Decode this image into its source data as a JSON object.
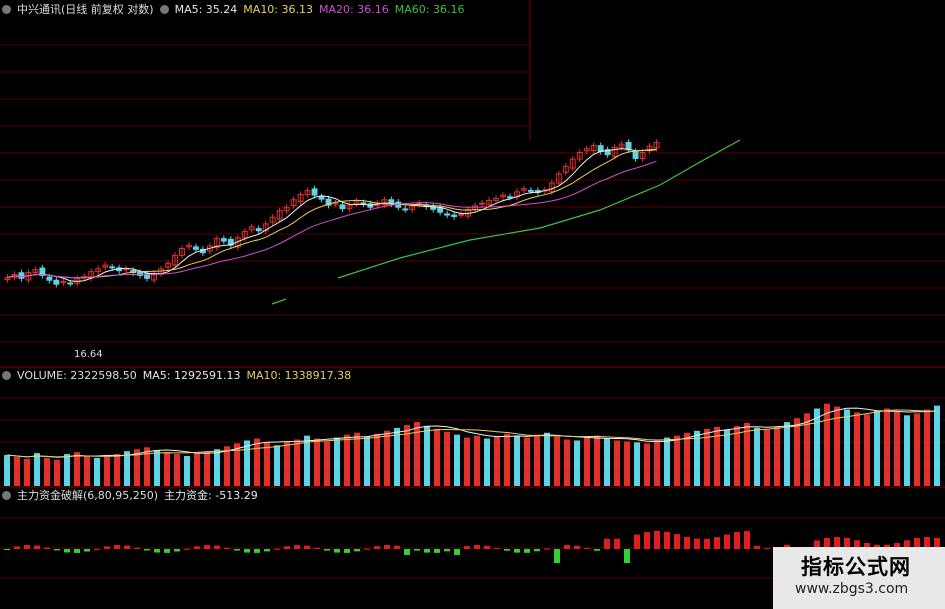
{
  "price_pane": {
    "title": "中兴通讯(日线 前复权 对数)",
    "ma5_label": "MA5: 35.24",
    "ma10_label": "MA10: 36.13",
    "ma20_label": "MA20: 36.16",
    "ma60_label": "MA60: 36.16",
    "low_marker": "16.64"
  },
  "volume_pane": {
    "title": "VOLUME: 2322598.50",
    "ma5_label": "MA5: 1292591.13",
    "ma10_label": "MA10: 1338917.38"
  },
  "indicator_pane": {
    "title": "主力资金破解(6,80,95,250)",
    "value_label": "主力资金: -513.29"
  },
  "watermark": {
    "title": "指标公式网",
    "url": "www.zbgs3.com"
  },
  "colors": {
    "up": "#e0322a",
    "down": "#5fd3e6",
    "ma5": "#f0f0f0",
    "ma10": "#e8d060",
    "ma20": "#d050d0",
    "ma60": "#40c040",
    "grid": "#5a0000"
  },
  "chart_data": {
    "type": "candlestick",
    "price_close": [
      22,
      22.3,
      21.9,
      22.5,
      22.8,
      22.2,
      21.7,
      21.3,
      21.6,
      21.4,
      21.9,
      22.1,
      22.6,
      22.9,
      23.3,
      23,
      22.7,
      22.9,
      22.5,
      22.2,
      21.9,
      22.4,
      22.9,
      23.5,
      24.4,
      25.2,
      25.6,
      25.1,
      24.7,
      25.5,
      26.4,
      26.1,
      25.6,
      26.5,
      27.3,
      27.9,
      27.4,
      28.3,
      29.2,
      30.1,
      30.6,
      31.7,
      32.5,
      33.1,
      32.4,
      31.8,
      30.9,
      31.2,
      30.4,
      30.9,
      31.5,
      31.1,
      30.6,
      31.2,
      31.7,
      31.1,
      30.6,
      30.3,
      30.8,
      31.2,
      30.7,
      30.3,
      29.9,
      29.5,
      29.3,
      29.6,
      30.3,
      30.8,
      31.2,
      31.6,
      31.9,
      32.4,
      32.1,
      32.9,
      33.4,
      33.1,
      32.8,
      33.2,
      34.3,
      35.8,
      37.1,
      38.4,
      39.6,
      40.3,
      40.9,
      39.8,
      39.2,
      40.6,
      41.2,
      40.1,
      38.5,
      39.6,
      40.8,
      41.5
    ],
    "volume": [
      32,
      30,
      28,
      34,
      29,
      27,
      33,
      35,
      31,
      29,
      30,
      33,
      36,
      38,
      40,
      37,
      35,
      33,
      31,
      34,
      36,
      38,
      41,
      44,
      47,
      49,
      45,
      42,
      46,
      48,
      52,
      49,
      46,
      50,
      53,
      55,
      51,
      54,
      57,
      60,
      63,
      66,
      62,
      59,
      56,
      53,
      50,
      52,
      49,
      51,
      54,
      52,
      50,
      53,
      55,
      51,
      48,
      47,
      50,
      52,
      49,
      47,
      46,
      45,
      44,
      47,
      50,
      52,
      55,
      57,
      59,
      61,
      58,
      62,
      65,
      60,
      58,
      61,
      66,
      70,
      75,
      80,
      85,
      82,
      79,
      76,
      74,
      78,
      80,
      77,
      73,
      75,
      79,
      83
    ]
  }
}
